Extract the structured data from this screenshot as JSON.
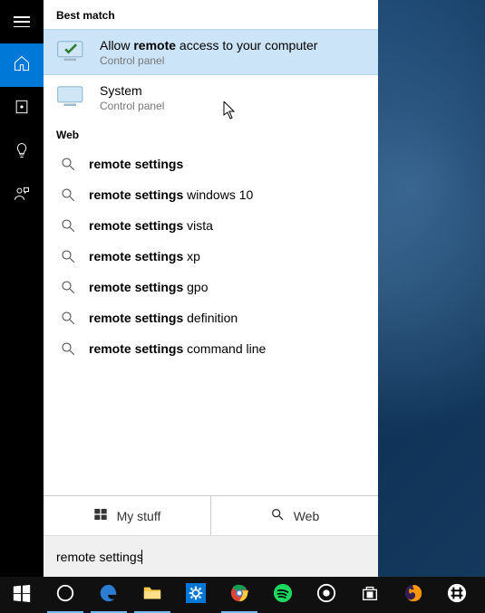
{
  "sidebar": {
    "items": [
      "menu",
      "home",
      "square",
      "bulb",
      "contact"
    ]
  },
  "search": {
    "best_match_header": "Best match",
    "web_header": "Web",
    "results": [
      {
        "title_prefix": "Allow ",
        "title_bold": "remote",
        "title_suffix": " access to your computer",
        "sub": "Control panel"
      },
      {
        "title_prefix": "",
        "title_bold": "",
        "title_suffix": "System",
        "sub": "Control panel"
      }
    ],
    "web": [
      {
        "bold": "remote settings",
        "rest": ""
      },
      {
        "bold": "remote settings",
        "rest": " windows 10"
      },
      {
        "bold": "remote settings",
        "rest": " vista"
      },
      {
        "bold": "remote settings",
        "rest": " xp"
      },
      {
        "bold": "remote settings",
        "rest": " gpo"
      },
      {
        "bold": "remote settings",
        "rest": " definition"
      },
      {
        "bold": "remote settings",
        "rest": " command line"
      }
    ],
    "filter_mystuff": "My stuff",
    "filter_web": "Web",
    "query": "remote settings"
  },
  "taskbar": {
    "items": [
      "start",
      "cortana",
      "edge",
      "file-explorer",
      "settings",
      "chrome",
      "spotify",
      "groove",
      "store",
      "firefox",
      "slack"
    ]
  }
}
